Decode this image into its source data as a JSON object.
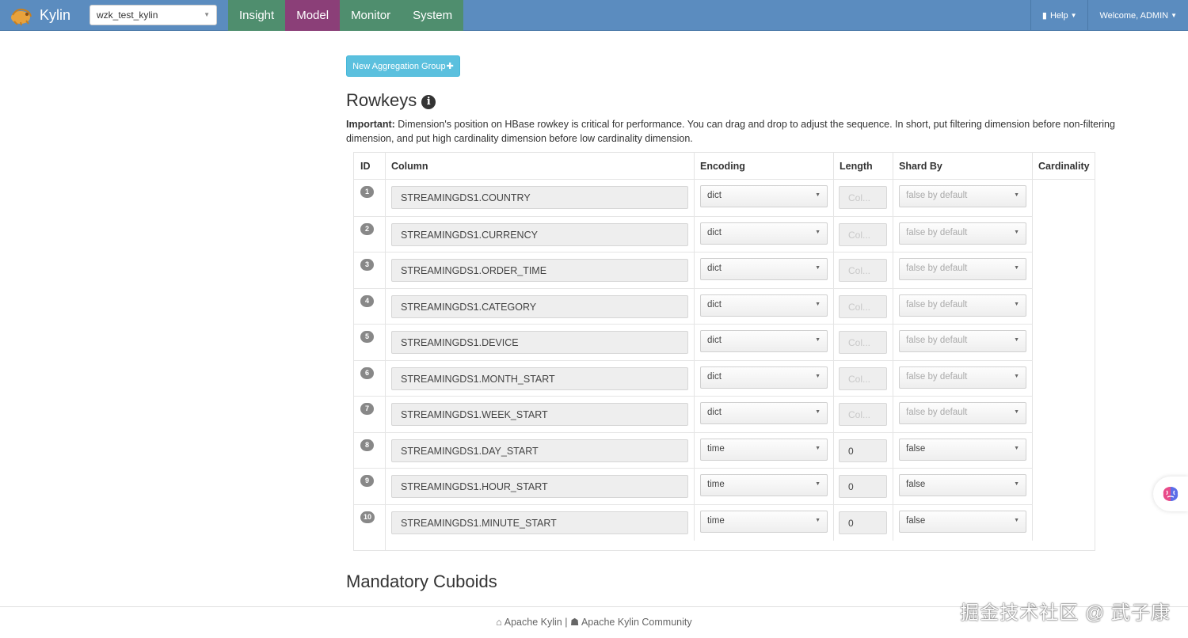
{
  "header": {
    "brand": "Kylin",
    "project": "wzk_test_kylin",
    "tabs": [
      {
        "label": "Insight",
        "active": false
      },
      {
        "label": "Model",
        "active": true
      },
      {
        "label": "Monitor",
        "active": false
      },
      {
        "label": "System",
        "active": false
      }
    ],
    "help_label": "Help",
    "welcome_label": "Welcome, ADMIN"
  },
  "actions": {
    "new_agg_group": "New Aggregation Group"
  },
  "rowkeys": {
    "title": "Rowkeys",
    "important_label": "Important:",
    "important_text": " Dimension's position on HBase rowkey is critical for performance. You can drag and drop to adjust the sequence. In short, put filtering dimension before non-filtering dimension, and put high cardinality dimension before low cardinality dimension.",
    "headers": [
      "ID",
      "Column",
      "Encoding",
      "Length",
      "Shard By",
      "Cardinality"
    ],
    "rows": [
      {
        "id": "1",
        "column": "STREAMINGDS1.COUNTRY",
        "encoding": "dict",
        "length": "Col...",
        "shard": "false by default"
      },
      {
        "id": "2",
        "column": "STREAMINGDS1.CURRENCY",
        "encoding": "dict",
        "length": "Col...",
        "shard": "false by default"
      },
      {
        "id": "3",
        "column": "STREAMINGDS1.ORDER_TIME",
        "encoding": "dict",
        "length": "Col...",
        "shard": "false by default"
      },
      {
        "id": "4",
        "column": "STREAMINGDS1.CATEGORY",
        "encoding": "dict",
        "length": "Col...",
        "shard": "false by default"
      },
      {
        "id": "5",
        "column": "STREAMINGDS1.DEVICE",
        "encoding": "dict",
        "length": "Col...",
        "shard": "false by default"
      },
      {
        "id": "6",
        "column": "STREAMINGDS1.MONTH_START",
        "encoding": "dict",
        "length": "Col...",
        "shard": "false by default"
      },
      {
        "id": "7",
        "column": "STREAMINGDS1.WEEK_START",
        "encoding": "dict",
        "length": "Col...",
        "shard": "false by default"
      },
      {
        "id": "8",
        "column": "STREAMINGDS1.DAY_START",
        "encoding": "time",
        "length": "0",
        "shard": "false"
      },
      {
        "id": "9",
        "column": "STREAMINGDS1.HOUR_START",
        "encoding": "time",
        "length": "0",
        "shard": "false"
      },
      {
        "id": "10",
        "column": "STREAMINGDS1.MINUTE_START",
        "encoding": "time",
        "length": "0",
        "shard": "false"
      }
    ]
  },
  "mandatory": {
    "title": "Mandatory Cuboids"
  },
  "footer": {
    "link1": "Apache Kylin",
    "separator": "|",
    "link2": "Apache Kylin Community"
  },
  "watermark": "掘金技术社区 @ 武子康"
}
